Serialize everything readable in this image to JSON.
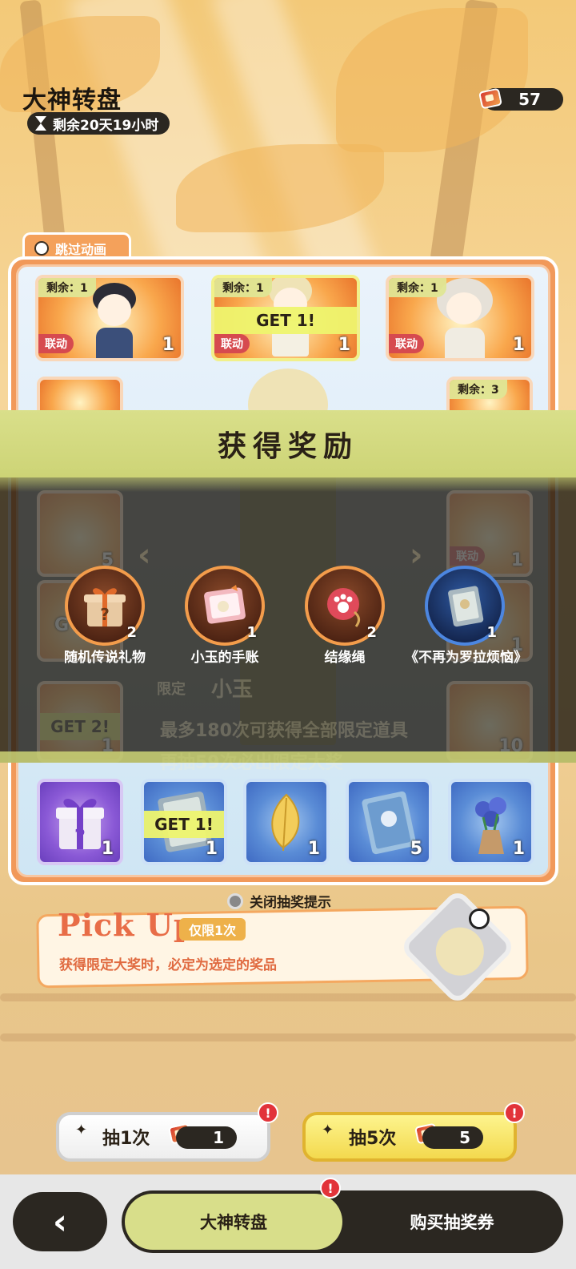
{
  "header": {
    "title": "大神转盘",
    "timer": "剩余20天19小时",
    "ticket_balance": "57"
  },
  "board": {
    "skip_animation": "跳过动画",
    "top_row": [
      {
        "remain": "剩余：1",
        "tag": "联动",
        "count": "1",
        "banner": ""
      },
      {
        "remain": "剩余：1",
        "tag": "联动",
        "count": "1",
        "banner": "GET 1!"
      },
      {
        "remain": "剩余：1",
        "tag": "联动",
        "count": "1",
        "banner": ""
      }
    ],
    "right_cell_remain": "剩余：3",
    "bottom_row": [
      {
        "count": "1",
        "banner": "",
        "icon": "mystery-gift-icon"
      },
      {
        "count": "1",
        "banner": "GET 1!",
        "icon": "book-icon"
      },
      {
        "count": "1",
        "banner": "",
        "icon": "golden-leaf-icon"
      },
      {
        "count": "5",
        "banner": "",
        "icon": "card-icon"
      },
      {
        "count": "1",
        "banner": "",
        "icon": "bouquet-icon"
      }
    ],
    "faded": {
      "left_count": "5",
      "left_get": "GET 2!",
      "left_count_2": "1",
      "right_tag": "联动",
      "right_count": "1",
      "right_count_2": "1",
      "right_count_3": "10",
      "limited_label": "限定",
      "limited_name": "小玉",
      "hint1": "最多180次可获得全部限定道具",
      "hint2": "再抽59次必出限定大奖",
      "left_get_partial": "G"
    }
  },
  "reward_popup": {
    "title": "获得奖励",
    "items": [
      {
        "name": "随机传说礼物",
        "qty": "2",
        "icon": "mystery-gift-icon"
      },
      {
        "name": "小玉的手账",
        "qty": "1",
        "icon": "journal-icon"
      },
      {
        "name": "结缘绳",
        "qty": "2",
        "icon": "paw-charm-icon"
      },
      {
        "name": "《不再为罗拉烦恼》",
        "qty": "1",
        "icon": "book-icon"
      }
    ]
  },
  "close_hint": "关闭抽奖提示",
  "pickup": {
    "title": "Pick Up",
    "badge": "仅限1次",
    "desc": "获得限定大奖时，必定为选定的奖品"
  },
  "draw_buttons": [
    {
      "label": "抽1次",
      "cost": "1"
    },
    {
      "label": "抽5次",
      "cost": "5"
    }
  ],
  "nav": {
    "tabs": [
      "大神转盘",
      "购买抽奖券"
    ]
  },
  "colors": {
    "accent_yellow": "#d8de8a",
    "alert_red": "#e2333a",
    "dark": "#2b2721"
  }
}
